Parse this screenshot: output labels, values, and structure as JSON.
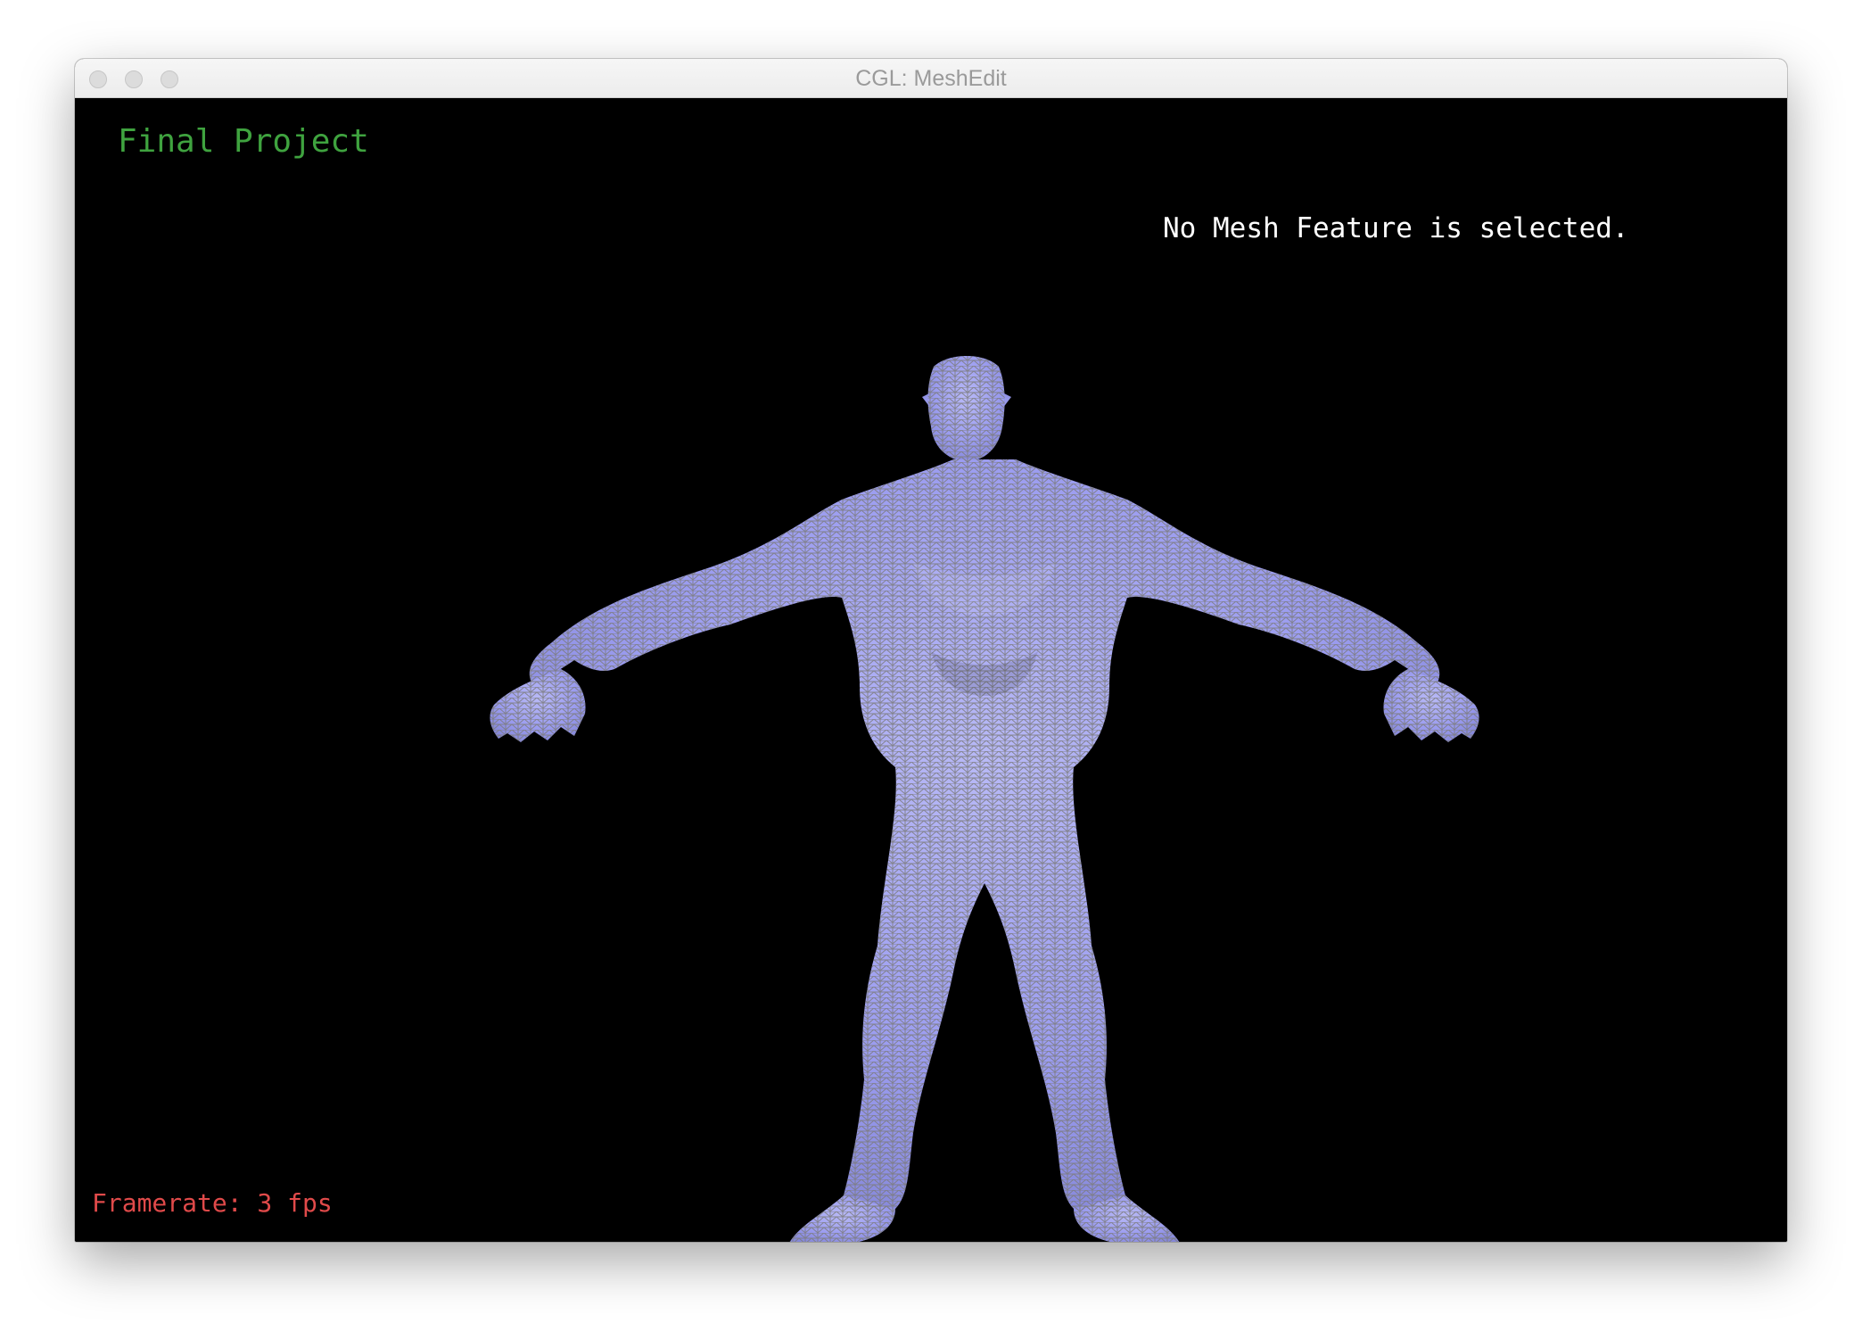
{
  "window": {
    "title": "CGL: MeshEdit",
    "controls": [
      "close-button",
      "minimize-button",
      "zoom-button"
    ]
  },
  "overlay": {
    "project_title": "Final Project",
    "selection_status": "No Mesh Feature is selected.",
    "framerate": "Framerate: 3 fps"
  },
  "scene": {
    "background_color": "#000000",
    "mesh_color": "#a7a9f2",
    "wireframe_color": "#7a7a7a",
    "title_color": "#3fa33f",
    "framerate_color": "#e04a4a"
  }
}
